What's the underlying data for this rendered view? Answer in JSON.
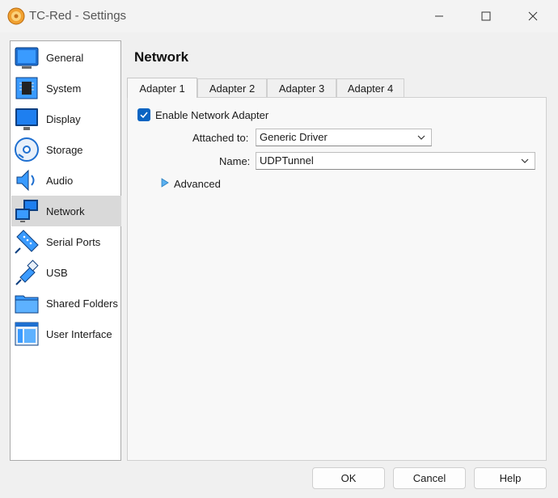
{
  "window": {
    "title": "TC-Red - Settings"
  },
  "sidebar": {
    "items": [
      {
        "label": "General",
        "icon": "general-icon"
      },
      {
        "label": "System",
        "icon": "system-icon"
      },
      {
        "label": "Display",
        "icon": "display-icon"
      },
      {
        "label": "Storage",
        "icon": "storage-icon"
      },
      {
        "label": "Audio",
        "icon": "audio-icon"
      },
      {
        "label": "Network",
        "icon": "network-icon",
        "selected": true
      },
      {
        "label": "Serial Ports",
        "icon": "serial-ports-icon"
      },
      {
        "label": "USB",
        "icon": "usb-icon"
      },
      {
        "label": "Shared Folders",
        "icon": "shared-folders-icon"
      },
      {
        "label": "User Interface",
        "icon": "user-interface-icon"
      }
    ]
  },
  "main": {
    "heading": "Network",
    "tabs": [
      {
        "label": "Adapter 1",
        "active": true
      },
      {
        "label": "Adapter 2"
      },
      {
        "label": "Adapter 3"
      },
      {
        "label": "Adapter 4"
      }
    ],
    "enable_adapter": {
      "label": "Enable Network Adapter",
      "checked": true
    },
    "attached_to": {
      "label": "Attached to:",
      "value": "Generic Driver"
    },
    "name": {
      "label": "Name:",
      "value": "UDPTunnel"
    },
    "advanced": {
      "label": "Advanced"
    }
  },
  "buttons": {
    "ok": "OK",
    "cancel": "Cancel",
    "help": "Help"
  },
  "colors": {
    "accent": "#0a64c2",
    "selected_bg": "#d9d9d9"
  }
}
